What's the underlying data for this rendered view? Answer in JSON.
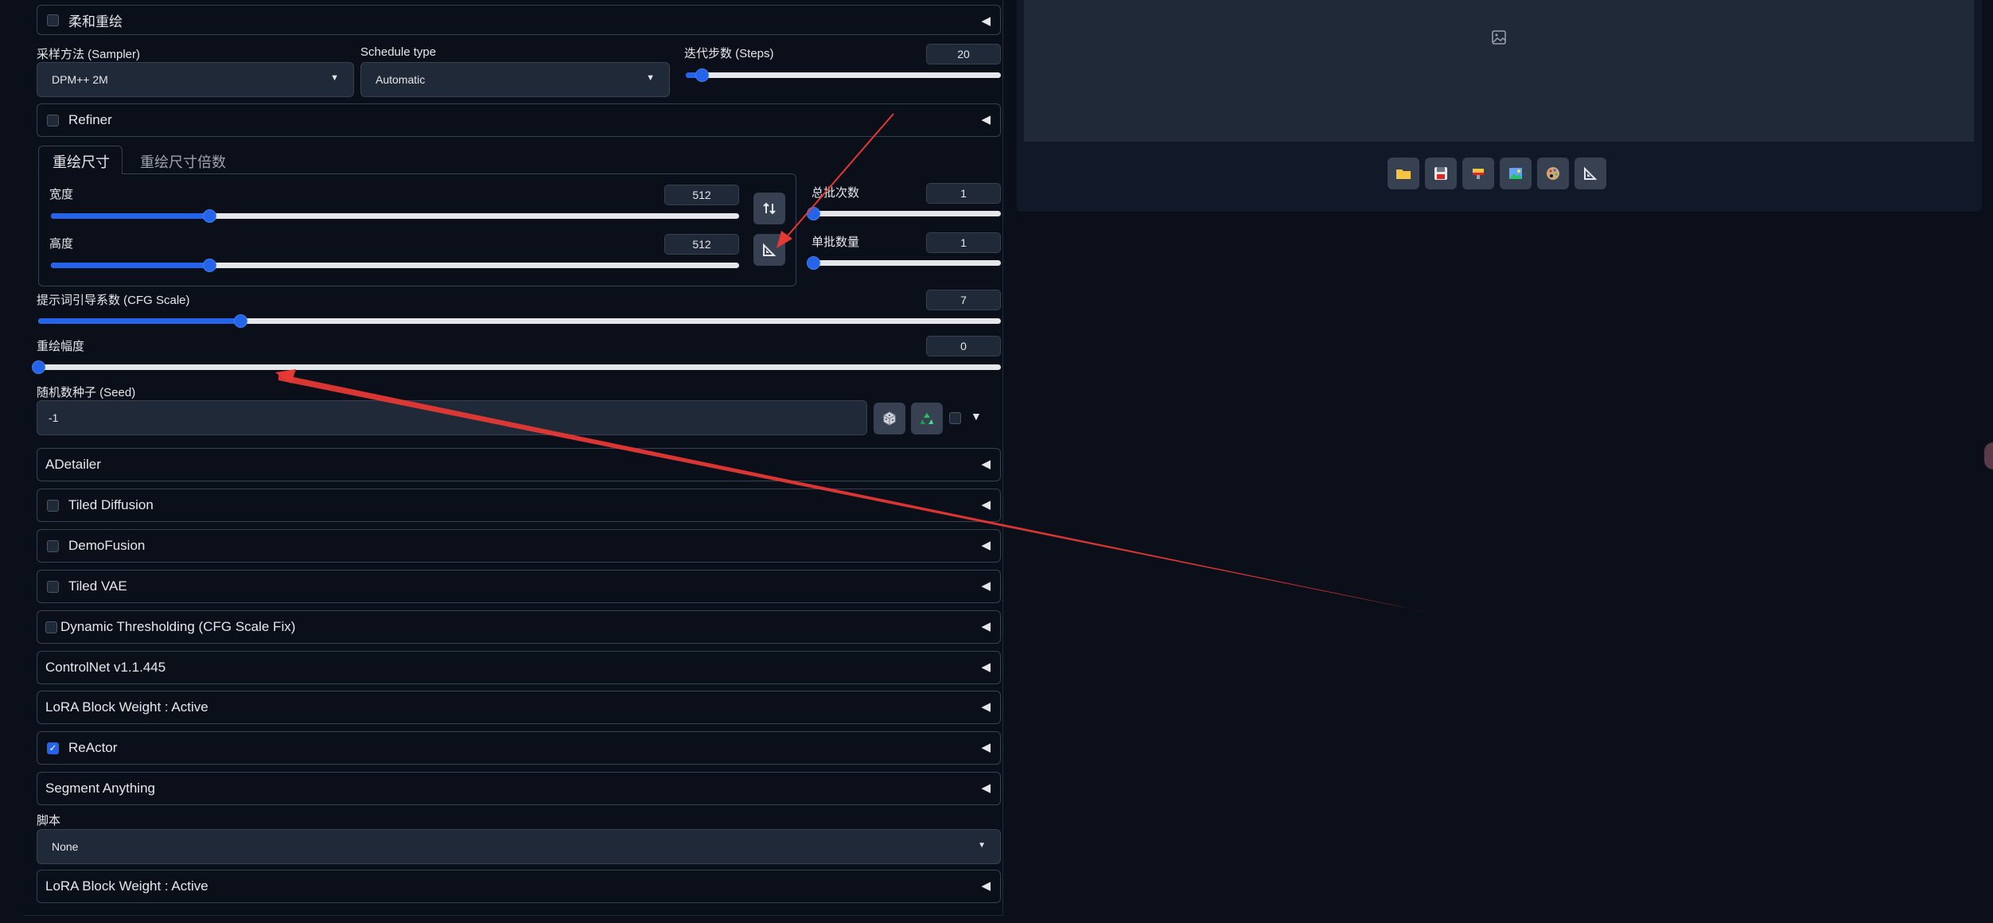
{
  "accordions": {
    "soft_inpaint": "柔和重绘",
    "refiner": "Refiner",
    "adetailer": "ADetailer",
    "tiled_diffusion": "Tiled Diffusion",
    "demofusion": "DemoFusion",
    "tiled_vae": "Tiled VAE",
    "dynamic_thresholding": "Dynamic Thresholding (CFG Scale Fix)",
    "controlnet": "ControlNet v1.1.445",
    "lora_block_weight": "LoRA Block Weight : Active",
    "reactor": "ReActor",
    "segment_anything": "Segment Anything",
    "lora_block_weight_2": "LoRA Block Weight : Active"
  },
  "sampler": {
    "label": "采样方法 (Sampler)",
    "value": "DPM++ 2M"
  },
  "schedule": {
    "label": "Schedule type",
    "value": "Automatic"
  },
  "steps": {
    "label": "迭代步数 (Steps)",
    "value": "20",
    "fraction": 0.05
  },
  "size_tabs": {
    "active": "重绘尺寸",
    "inactive": "重绘尺寸倍数"
  },
  "width": {
    "label": "宽度",
    "value": "512",
    "fraction": 0.23
  },
  "height": {
    "label": "高度",
    "value": "512",
    "fraction": 0.23
  },
  "batch_count": {
    "label": "总批次数",
    "value": "1",
    "fraction": 0.0
  },
  "batch_size": {
    "label": "单批数量",
    "value": "1",
    "fraction": 0.0
  },
  "cfg": {
    "label": "提示词引导系数 (CFG Scale)",
    "value": "7",
    "fraction": 0.21
  },
  "denoise": {
    "label": "重绘幅度",
    "value": "0",
    "fraction": 0.0
  },
  "seed": {
    "label": "随机数种子 (Seed)",
    "value": "-1"
  },
  "script": {
    "label": "脚本",
    "value": "None"
  },
  "colors": {
    "accent": "#2563eb",
    "bg": "#0b0f19",
    "panel": "#1f2937",
    "annotation": "#e53935"
  },
  "output_toolbar_icons": [
    "folder-icon",
    "save-icon",
    "zip-icon",
    "image-icon",
    "palette-icon",
    "ruler-icon"
  ]
}
